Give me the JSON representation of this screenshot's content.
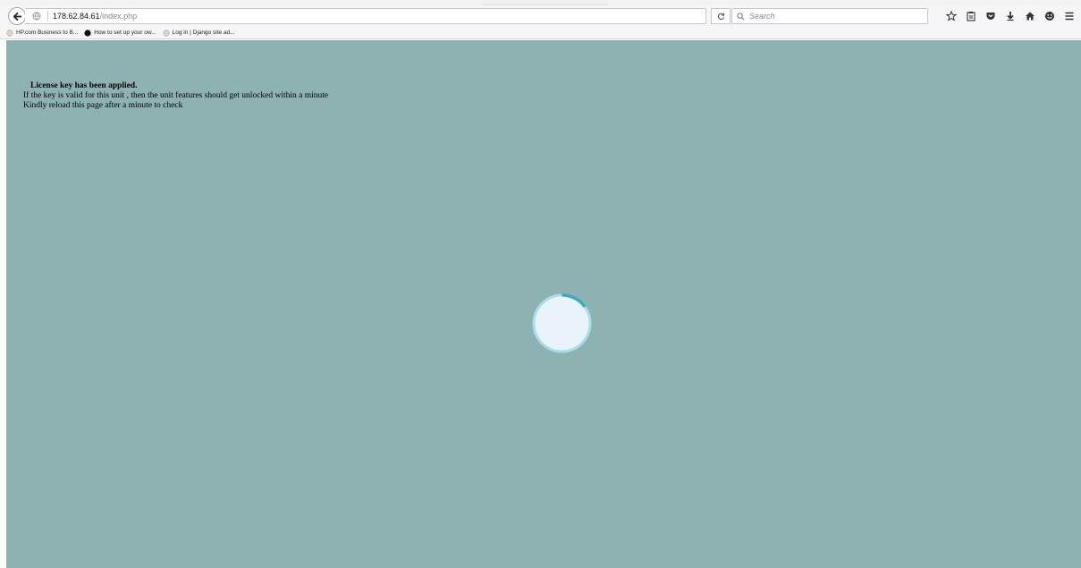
{
  "browser": {
    "url": {
      "host": "178.62.84.61",
      "path": "/index.php"
    },
    "search": {
      "placeholder": "Search"
    },
    "bookmarks": [
      {
        "label": "HP.com Business to B..."
      },
      {
        "label": "How to set up your ow..."
      },
      {
        "label": "Log in | Django site ad..."
      }
    ],
    "toolbar_icons": [
      "star-icon",
      "clipboard-icon",
      "pocket-icon",
      "download-icon",
      "home-icon",
      "smiley-icon",
      "hamburger-menu-icon"
    ]
  },
  "page": {
    "title": "License key has been applied.",
    "line1": "If the key is valid for this unit , then the unit features should get unlocked within a minute",
    "line2": "Kindly reload this page after a minute to check"
  },
  "colors": {
    "page_background": "#8eb1b1",
    "spinner_fill": "#e8f4fa",
    "spinner_ring": "#a8dde9",
    "spinner_arc": "#39a9c8"
  }
}
